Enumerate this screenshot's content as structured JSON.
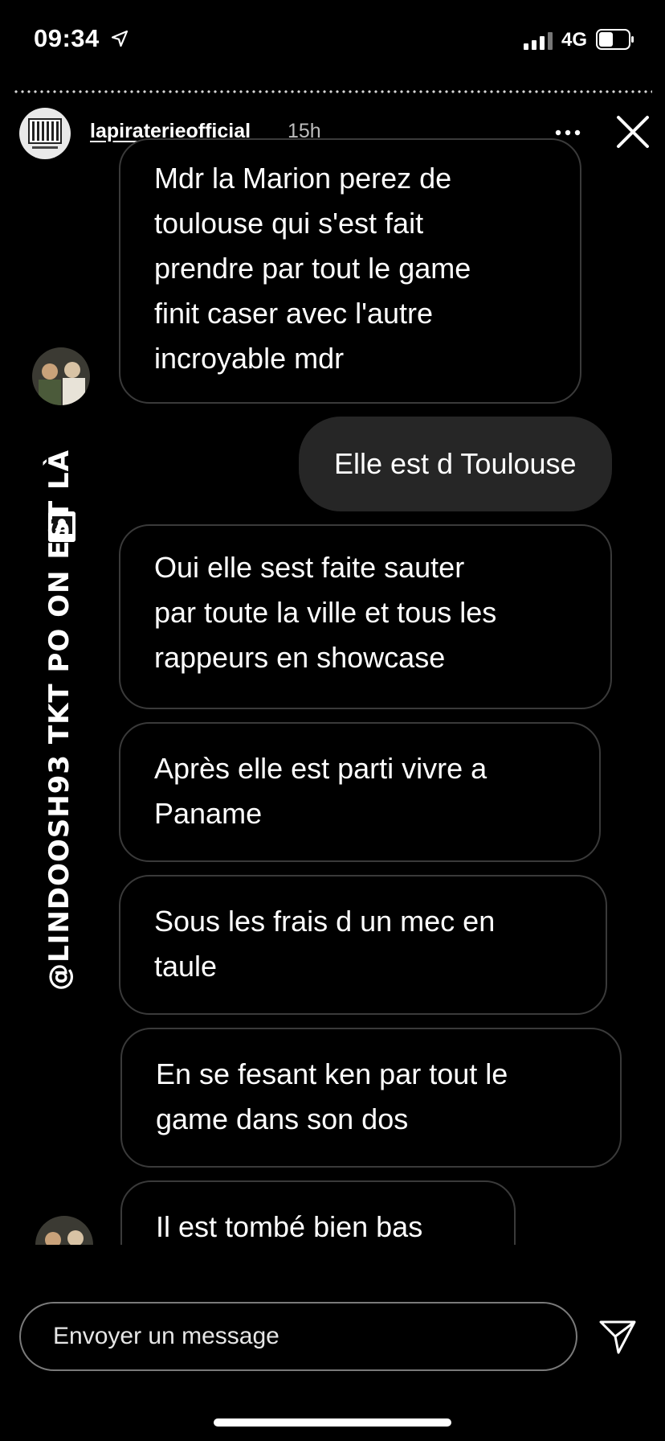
{
  "status_bar": {
    "time": "09:34",
    "network": "4G",
    "location_icon": "location-arrow-icon",
    "signal_icon": "cellular-signal-icon",
    "battery_icon": "battery-icon"
  },
  "story_header": {
    "username": "lapiraterieofficial",
    "time_ago": "15h",
    "avatar_icon": "brand-logo-avatar",
    "more_icon": "more-dots-icon",
    "close_icon": "close-icon"
  },
  "overlay_text": "@LINDOOSH93 TKT PO ON EST LÀ",
  "overlay_icon": "pirate-flag-icon",
  "messages": [
    {
      "side": "in",
      "lines": [
        "Mdr la Marion perez de",
        "toulouse qui s'est fait",
        "prendre par tout le game",
        "finit caser avec l'autre",
        "incroyable mdr"
      ]
    },
    {
      "side": "out",
      "lines": [
        "Elle est d Toulouse"
      ]
    },
    {
      "side": "in",
      "lines": [
        "Oui elle sest faite sauter",
        "par toute la ville et tous les",
        "rappeurs en showcase"
      ]
    },
    {
      "side": "in",
      "lines": [
        "Après elle est parti vivre a",
        "Paname"
      ]
    },
    {
      "side": "in",
      "lines": [
        "Sous les frais d un mec en",
        "taule"
      ]
    },
    {
      "side": "in",
      "lines": [
        "En se fesant ken par tout le",
        "game dans son dos"
      ]
    },
    {
      "side": "in",
      "lines": [
        "Il est tombé bien bas"
      ]
    }
  ],
  "reply": {
    "placeholder": "Envoyer un message",
    "send_icon": "send-paper-plane-icon"
  },
  "colors": {
    "background": "#000000",
    "incoming_border": "#3a3a3a",
    "outgoing_bubble": "#262626",
    "text": "#ffffff"
  }
}
